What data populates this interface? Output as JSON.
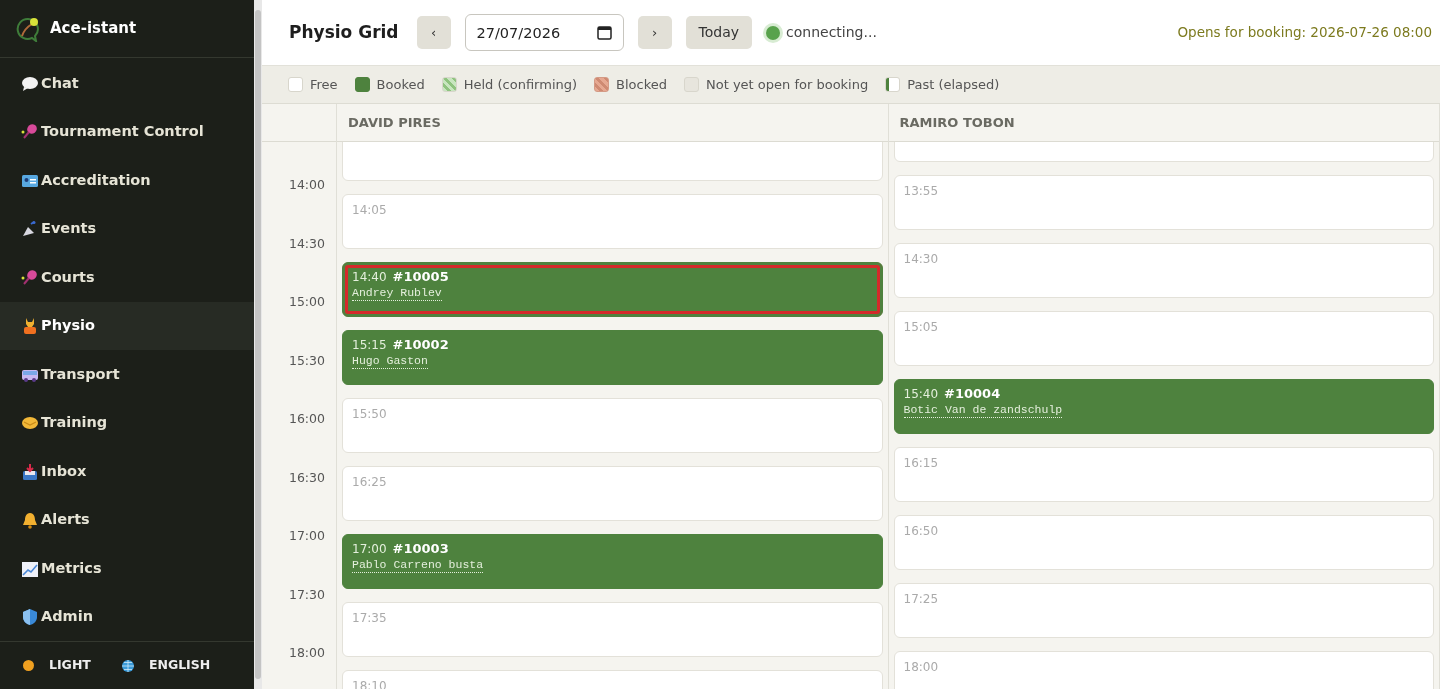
{
  "sidebar": {
    "brand": "Ace-istant",
    "items": [
      {
        "label": "Chat",
        "selected": false
      },
      {
        "label": "Tournament Control",
        "selected": false
      },
      {
        "label": "Accreditation",
        "selected": false
      },
      {
        "label": "Events",
        "selected": false
      },
      {
        "label": "Courts",
        "selected": false
      },
      {
        "label": "Physio",
        "selected": true
      },
      {
        "label": "Transport",
        "selected": false
      },
      {
        "label": "Training",
        "selected": false
      },
      {
        "label": "Inbox",
        "selected": false
      },
      {
        "label": "Alerts",
        "selected": false
      },
      {
        "label": "Metrics",
        "selected": false
      },
      {
        "label": "Admin",
        "selected": false
      }
    ],
    "footer": {
      "theme": "LIGHT",
      "language": "ENGLISH"
    }
  },
  "header": {
    "title": "Physio Grid",
    "prev": "‹",
    "date": "27/07/2026",
    "next": "›",
    "today": "Today",
    "status": "connecting...",
    "opens": "Opens for booking: 2026-07-26 08:00"
  },
  "legend": [
    {
      "kind": "free",
      "label": "Free"
    },
    {
      "kind": "booked",
      "label": "Booked"
    },
    {
      "kind": "held",
      "label": "Held (confirming)"
    },
    {
      "kind": "blocked",
      "label": "Blocked"
    },
    {
      "kind": "notopen",
      "label": "Not yet open for booking"
    },
    {
      "kind": "past",
      "label": "Past (elapsed)"
    }
  ],
  "times": [
    "14:00",
    "14:30",
    "15:00",
    "15:30",
    "16:00",
    "16:30",
    "17:00",
    "17:30",
    "18:00"
  ],
  "columns": [
    {
      "name": "DAVID PIRES",
      "slots": [
        {
          "kind": "cut"
        },
        {
          "kind": "free",
          "time": "14:05"
        },
        {
          "kind": "booked",
          "time": "14:40",
          "ref": "#10005",
          "player": "Andrey Rublev",
          "selected": true
        },
        {
          "kind": "booked",
          "time": "15:15",
          "ref": "#10002",
          "player": "Hugo Gaston",
          "selected": false
        },
        {
          "kind": "free",
          "time": "15:50"
        },
        {
          "kind": "free",
          "time": "16:25"
        },
        {
          "kind": "booked",
          "time": "17:00",
          "ref": "#10003",
          "player": "Pablo Carreno busta",
          "selected": false
        },
        {
          "kind": "free",
          "time": "17:35"
        },
        {
          "kind": "free",
          "time": "18:10"
        }
      ]
    },
    {
      "name": "RAMIRO TOBON",
      "slots": [
        {
          "kind": "cut"
        },
        {
          "kind": "free",
          "time": "13:55"
        },
        {
          "kind": "free",
          "time": "14:30"
        },
        {
          "kind": "free",
          "time": "15:05"
        },
        {
          "kind": "booked",
          "time": "15:40",
          "ref": "#10004",
          "player": "Botic Van de zandschulp",
          "selected": false
        },
        {
          "kind": "free",
          "time": "16:15"
        },
        {
          "kind": "free",
          "time": "16:50"
        },
        {
          "kind": "free",
          "time": "17:25"
        },
        {
          "kind": "free",
          "time": "18:00"
        }
      ]
    }
  ]
}
